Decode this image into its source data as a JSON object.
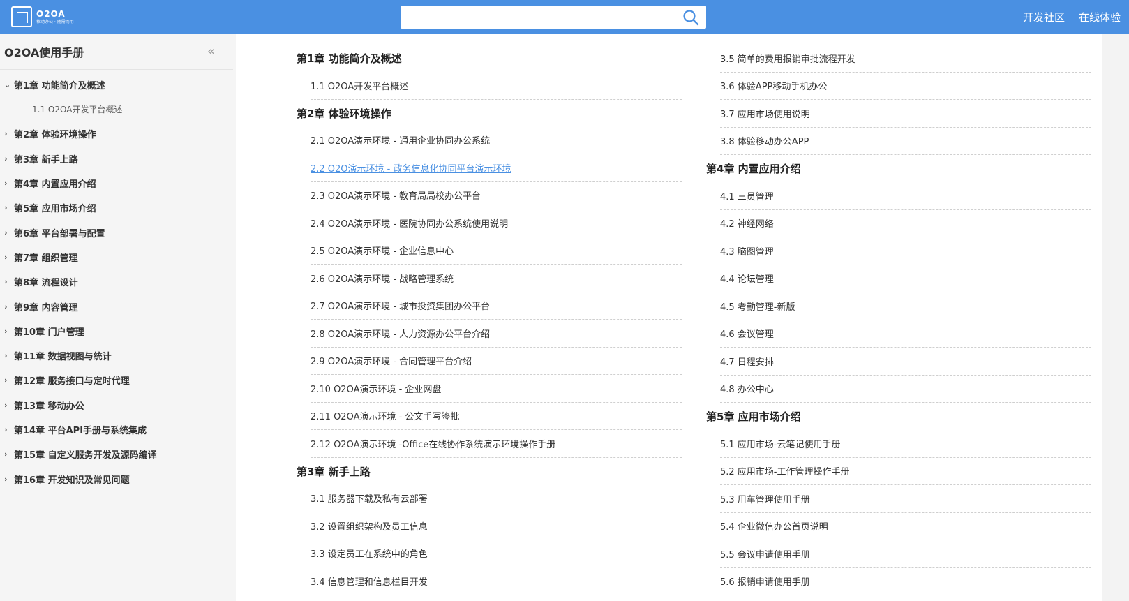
{
  "header": {
    "logo_name": "O2OA",
    "logo_slogan": "移动办公 · 随需而用",
    "search_placeholder": "",
    "links": [
      "开发社区",
      "在线体验"
    ]
  },
  "sidebar": {
    "title": "O2OA使用手册",
    "collapse_glyph": "«",
    "expanded_chev": "⌄",
    "collapsed_chev": "›",
    "items": [
      {
        "label": "第1章 功能简介及概述",
        "expanded": true,
        "children": [
          "1.1 O2OA开发平台概述"
        ]
      },
      {
        "label": "第2章 体验环境操作"
      },
      {
        "label": "第3章 新手上路"
      },
      {
        "label": "第4章 内置应用介绍"
      },
      {
        "label": "第5章 应用市场介绍"
      },
      {
        "label": "第6章 平台部署与配置"
      },
      {
        "label": "第7章 组织管理"
      },
      {
        "label": "第8章 流程设计"
      },
      {
        "label": "第9章 内容管理"
      },
      {
        "label": "第10章 门户管理"
      },
      {
        "label": "第11章 数据视图与统计"
      },
      {
        "label": "第12章 服务接口与定时代理"
      },
      {
        "label": "第13章 移动办公"
      },
      {
        "label": "第14章 平台API手册与系统集成"
      },
      {
        "label": "第15章 自定义服务开发及源码编译"
      },
      {
        "label": "第16章 开发知识及常见问题"
      }
    ]
  },
  "main": {
    "left_column": [
      {
        "type": "chapter",
        "label": "第1章 功能简介及概述"
      },
      {
        "type": "section",
        "label": "1.1 O2OA开发平台概述"
      },
      {
        "type": "chapter",
        "label": "第2章 体验环境操作"
      },
      {
        "type": "section",
        "label": "2.1 O2OA演示环境 - 通用企业协同办公系统"
      },
      {
        "type": "section",
        "label": "2.2 O2O演示环境 - 政务信息化协同平台演示环境",
        "active": true
      },
      {
        "type": "section",
        "label": "2.3 O2OA演示环境 - 教育局局校办公平台"
      },
      {
        "type": "section",
        "label": "2.4 O2OA演示环境 - 医院协同办公系统使用说明"
      },
      {
        "type": "section",
        "label": "2.5 O2OA演示环境 - 企业信息中心"
      },
      {
        "type": "section",
        "label": "2.6 O2OA演示环境 - 战略管理系统"
      },
      {
        "type": "section",
        "label": "2.7 O2OA演示环境 - 城市投资集团办公平台"
      },
      {
        "type": "section",
        "label": "2.8 O2OA演示环境 - 人力资源办公平台介绍"
      },
      {
        "type": "section",
        "label": "2.9 O2OA演示环境 - 合同管理平台介绍"
      },
      {
        "type": "section",
        "label": "2.10 O2OA演示环境 - 企业网盘"
      },
      {
        "type": "section",
        "label": "2.11 O2OA演示环境 - 公文手写签批"
      },
      {
        "type": "section",
        "label": "2.12 O2OA演示环境 -Office在线协作系统演示环境操作手册"
      },
      {
        "type": "chapter",
        "label": "第3章 新手上路"
      },
      {
        "type": "section",
        "label": "3.1 服务器下载及私有云部署"
      },
      {
        "type": "section",
        "label": "3.2 设置组织架构及员工信息"
      },
      {
        "type": "section",
        "label": "3.3 设定员工在系统中的角色"
      },
      {
        "type": "section",
        "label": "3.4 信息管理和信息栏目开发"
      }
    ],
    "right_column": [
      {
        "type": "section",
        "label": "3.5 简单的费用报销审批流程开发"
      },
      {
        "type": "section",
        "label": "3.6 体验APP移动手机办公"
      },
      {
        "type": "section",
        "label": "3.7 应用市场使用说明"
      },
      {
        "type": "section",
        "label": "3.8 体验移动办公APP"
      },
      {
        "type": "chapter",
        "label": "第4章 内置应用介绍"
      },
      {
        "type": "section",
        "label": "4.1 三员管理"
      },
      {
        "type": "section",
        "label": "4.2 神经网络"
      },
      {
        "type": "section",
        "label": "4.3 脑图管理"
      },
      {
        "type": "section",
        "label": "4.4 论坛管理"
      },
      {
        "type": "section",
        "label": "4.5 考勤管理-新版"
      },
      {
        "type": "section",
        "label": "4.6 会议管理"
      },
      {
        "type": "section",
        "label": "4.7 日程安排"
      },
      {
        "type": "section",
        "label": "4.8 办公中心"
      },
      {
        "type": "chapter",
        "label": "第5章 应用市场介绍"
      },
      {
        "type": "section",
        "label": "5.1 应用市场-云笔记使用手册"
      },
      {
        "type": "section",
        "label": "5.2 应用市场-工作管理操作手册"
      },
      {
        "type": "section",
        "label": "5.3 用车管理使用手册"
      },
      {
        "type": "section",
        "label": "5.4 企业微信办公首页说明"
      },
      {
        "type": "section",
        "label": "5.5 会议申请使用手册"
      },
      {
        "type": "section",
        "label": "5.6 报销申请使用手册"
      }
    ]
  },
  "colors": {
    "topbar": "#4a90e2",
    "link_active": "#4a90e2",
    "sidebar_bg": "#f5f5f5"
  }
}
